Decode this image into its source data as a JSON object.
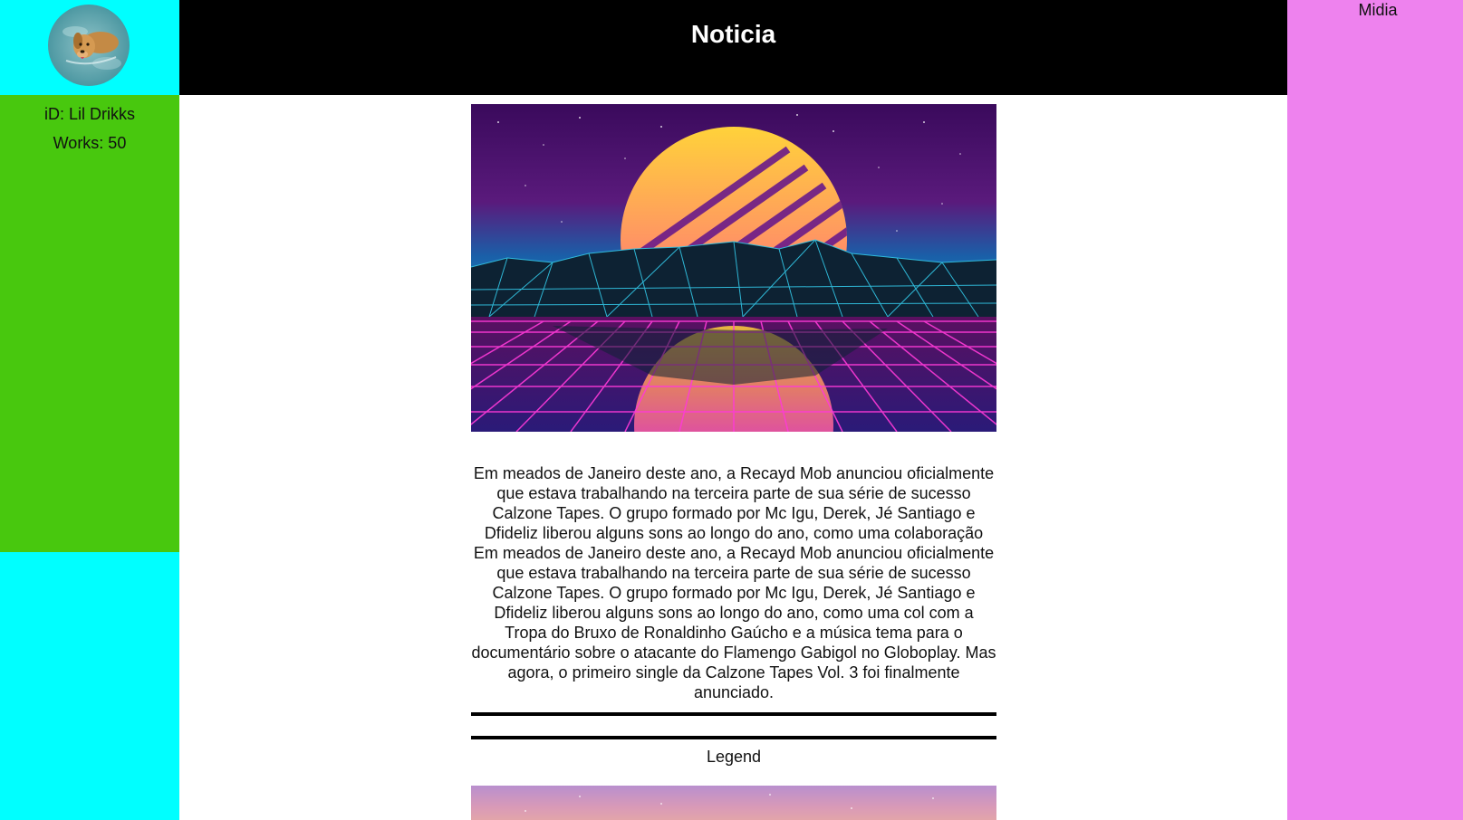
{
  "header": {
    "title": "Noticia"
  },
  "sidebar_left": {
    "avatar_icon": "dog-swimming-photo",
    "user_id": "iD: Lil Drikks",
    "works": "Works: 50"
  },
  "sidebar_right": {
    "title": "Midia"
  },
  "article": {
    "hero_image": "synthwave-sunset-grid-image",
    "body": "Em meados de Janeiro deste ano, a Recayd Mob anunciou oficialmente que estava trabalhando na terceira parte de sua série de sucesso Calzone Tapes. O grupo formado por Mc Igu, Derek, Jé Santiago e Dfideliz liberou alguns sons ao longo do ano, como uma colaboração Em meados de Janeiro deste ano, a Recayd Mob anunciou oficialmente que estava trabalhando na terceira parte de sua série de sucesso Calzone Tapes. O grupo formado por Mc Igu, Derek, Jé Santiago e Dfideliz liberou alguns sons ao longo do ano, como uma col com a Tropa do Bruxo de Ronaldinho Gaúcho e a música tema para o documentário sobre o atacante do Flamengo Gabigol no Globoplay. Mas agora, o primeiro single da Calzone Tapes Vol. 3 foi finalmente anunciado.",
    "legend": "Legend",
    "second_image": "synthwave-sky-image"
  },
  "colors": {
    "left_top": "#00ffff",
    "left_info": "#48c80e",
    "header": "#000000",
    "right": "#ee82ee"
  }
}
